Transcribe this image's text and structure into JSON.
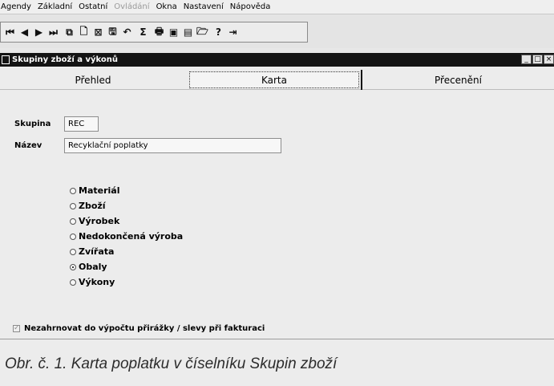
{
  "menu": [
    {
      "label": "Agendy",
      "disabled": false
    },
    {
      "label": "Základní",
      "disabled": false
    },
    {
      "label": "Ostatní",
      "disabled": false
    },
    {
      "label": "Ovládání",
      "disabled": true
    },
    {
      "label": "Okna",
      "disabled": false
    },
    {
      "label": "Nastavení",
      "disabled": false
    },
    {
      "label": "Nápověda",
      "disabled": false
    }
  ],
  "toolbar": {
    "buttons": [
      {
        "name": "first-record-icon",
        "glyph": "⏮"
      },
      {
        "name": "prev-record-icon",
        "glyph": "◀"
      },
      {
        "name": "next-record-icon",
        "glyph": "▶"
      },
      {
        "name": "last-record-icon",
        "glyph": "⏭"
      },
      {
        "name": "copy-record-icon",
        "glyph": "⧉"
      },
      {
        "name": "new-record-icon",
        "glyph": "🗋"
      },
      {
        "name": "delete-record-icon",
        "glyph": "⊠"
      },
      {
        "name": "save-icon",
        "glyph": "🖫"
      },
      {
        "name": "undo-icon",
        "glyph": "↶"
      },
      {
        "name": "sum-icon",
        "glyph": "Σ"
      },
      {
        "name": "print-icon",
        "glyph": "🖶"
      },
      {
        "name": "print-preview-icon",
        "glyph": "▣"
      },
      {
        "name": "export-icon",
        "glyph": "▤"
      },
      {
        "name": "open-folder-icon",
        "glyph": "🗁"
      },
      {
        "name": "help-icon",
        "glyph": "?"
      },
      {
        "name": "exit-icon",
        "glyph": "⇥"
      }
    ]
  },
  "window": {
    "title": "Skupiny zboží a výkonů",
    "controls": {
      "minimize": "_",
      "maximize": "□",
      "close": "×"
    }
  },
  "tabs": [
    {
      "label": "Přehled"
    },
    {
      "label": "Karta"
    },
    {
      "label": "Přecenění"
    }
  ],
  "form": {
    "skupina_label": "Skupina",
    "skupina_value": "REC",
    "nazev_label": "Název",
    "nazev_value": "Recyklační poplatky",
    "radio_options": [
      {
        "label": "Materiál",
        "checked": false
      },
      {
        "label": "Zboží",
        "checked": false
      },
      {
        "label": "Výrobek",
        "checked": false
      },
      {
        "label": "Nedokončená výroba",
        "checked": false
      },
      {
        "label": "Zvířata",
        "checked": false
      },
      {
        "label": "Obaly",
        "checked": true
      },
      {
        "label": "Výkony",
        "checked": false
      }
    ],
    "checkbox_label": "Nezahrnovat do výpočtu přirážky / slevy  při fakturaci",
    "checkbox_checked": true
  },
  "caption": "Obr. č. 1. Karta poplatku v číselníku Skupin zboží"
}
